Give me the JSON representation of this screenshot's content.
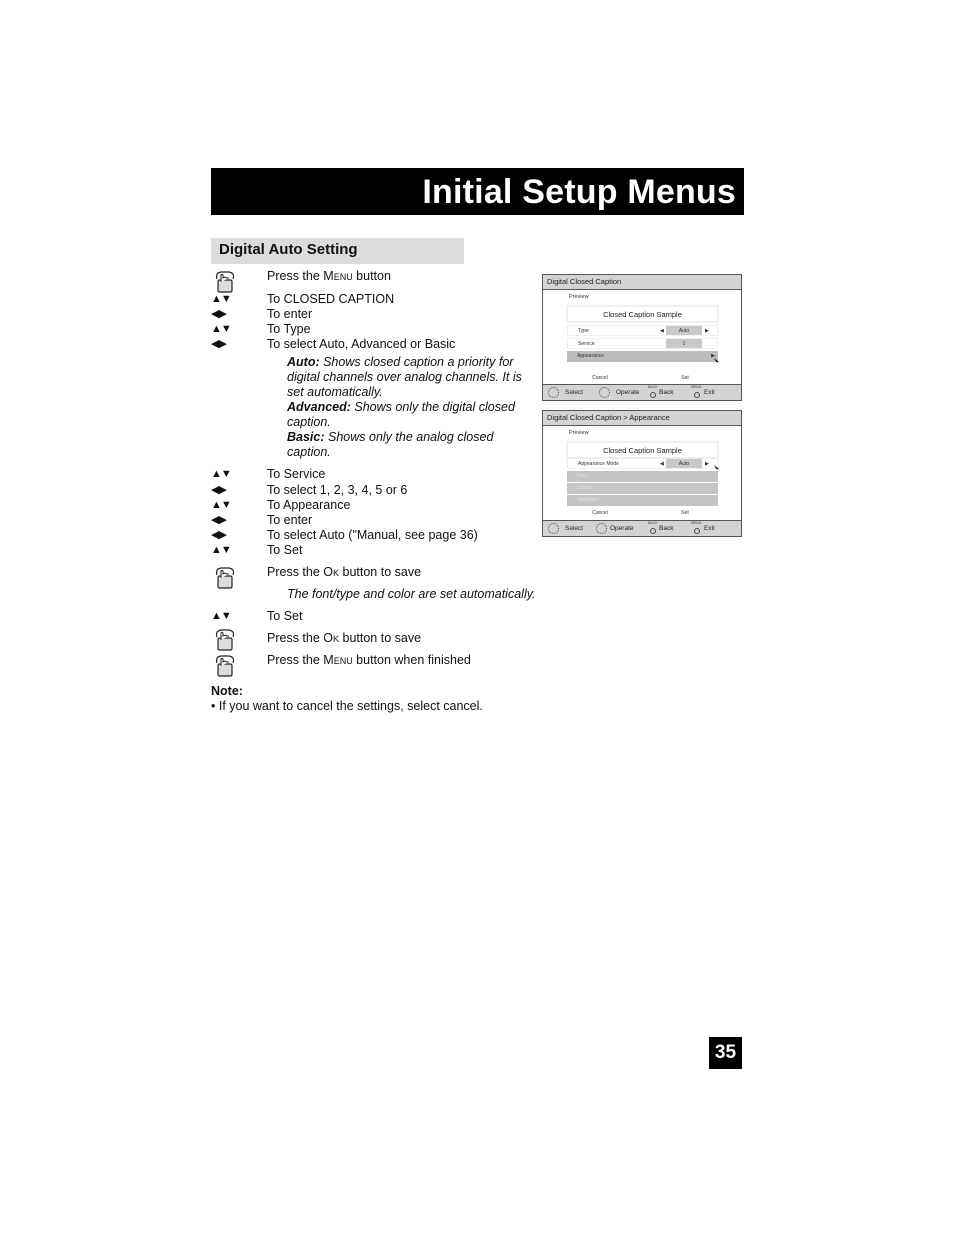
{
  "header": {
    "title": "Initial Setup Menus"
  },
  "section": {
    "title": "Digital Auto Setting"
  },
  "steps": [
    {
      "icon": "hand",
      "pre": "Press the ",
      "key": "Menu",
      "post": " button"
    },
    {
      "icon": "up-down",
      "icon_text": "▲▼",
      "text": "To CLOSED CAPTION"
    },
    {
      "icon": "left-right",
      "icon_text": "◀▶",
      "text": "To enter"
    },
    {
      "icon": "up-down",
      "icon_text": "▲▼",
      "text": "To Type"
    },
    {
      "icon": "left-right",
      "icon_text": "◀▶",
      "text": "To select Auto, Advanced or Basic"
    },
    {
      "icon": "up-down",
      "icon_text": "▲▼",
      "text": "To Service"
    },
    {
      "icon": "left-right",
      "icon_text": "◀▶",
      "text": "To select 1, 2, 3, 4, 5 or 6"
    },
    {
      "icon": "up-down",
      "icon_text": "▲▼",
      "text": "To Appearance"
    },
    {
      "icon": "left-right",
      "icon_text": "◀▶",
      "text": "To enter"
    },
    {
      "icon": "left-right",
      "icon_text": "◀▶",
      "text": "To select Auto (\"Manual, see page 36)"
    },
    {
      "icon": "up-down",
      "icon_text": "▲▼",
      "text": "To Set"
    },
    {
      "icon": "hand",
      "pre": "Press the ",
      "key": "Ok",
      "post": " button to save"
    },
    {
      "icon": "up-down",
      "icon_text": "▲▼",
      "text": "To Set"
    },
    {
      "icon": "hand",
      "pre": "Press the ",
      "key": "Ok",
      "post": " button to save"
    },
    {
      "icon": "hand",
      "pre": "Press the ",
      "key": "Menu",
      "post": " button when finished"
    }
  ],
  "type_descriptions": [
    {
      "term": "Auto:",
      "text": "  Shows closed caption a priority for digital channels over analog channels.  It is set automatically."
    },
    {
      "term": "Advanced:",
      "text": "  Shows only the digital closed caption."
    },
    {
      "term": "Basic:",
      "text": "  Shows only the analog closed caption."
    }
  ],
  "auto_note": "The font/type and color are set automatically.",
  "note": {
    "label": "Note:",
    "items": [
      "•  If you want to cancel the settings, select cancel."
    ]
  },
  "screens": [
    {
      "title": "Digital Closed Caption",
      "preview_label": "Preview",
      "sample": "Closed Caption Sample",
      "rows": [
        {
          "label": "Type",
          "value": "Auto",
          "arrows": true
        },
        {
          "label": "Service",
          "value": "1",
          "arrows": false
        },
        {
          "label": "Appearance",
          "value": "",
          "arrows": false,
          "selected": true
        }
      ],
      "buttons": [
        "Cancel",
        "Set"
      ]
    },
    {
      "title": "Digital Closed Caption  >  Appearance",
      "preview_label": "Preview",
      "sample": "Closed Caption Sample",
      "rows": [
        {
          "label": "Appearance Mode",
          "value": "Auto",
          "arrows": true
        },
        {
          "label": "Font",
          "disabled": true
        },
        {
          "label": "Colors",
          "disabled": true
        },
        {
          "label": "Opacities",
          "disabled": true
        }
      ],
      "buttons": [
        "Cancel",
        "Set"
      ]
    }
  ],
  "footer_legend": {
    "select": "Select",
    "operate": "Operate",
    "back_key": "BACK",
    "back": "Back",
    "menu_key": "MENU",
    "exit": "Exit"
  },
  "page_number": "35"
}
